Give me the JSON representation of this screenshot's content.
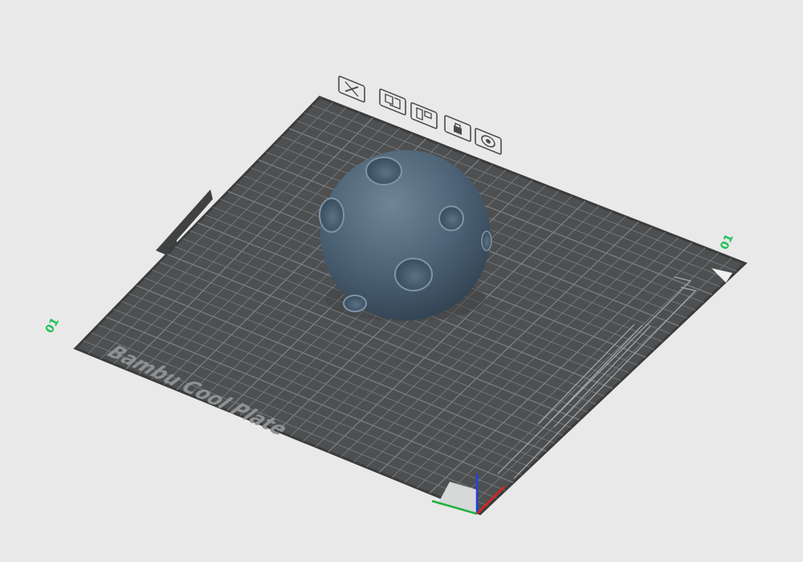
{
  "scene": {
    "background_color": "#e9e9e9",
    "plate_color": "#4d4f50",
    "grid_color": "#7c7e80",
    "model_color": "#4a6175",
    "number_color": "#22c05a"
  },
  "plate": {
    "brand_label": "Bambu Cool Plate",
    "number_left": "01",
    "number_right": "01"
  },
  "plate_toolbar": {
    "items": [
      {
        "name": "close-icon",
        "label": "remove plate"
      },
      {
        "name": "arrange-icon",
        "label": "arrange objects"
      },
      {
        "name": "orient-icon",
        "label": "auto orient"
      },
      {
        "name": "lock-icon",
        "label": "lock plate"
      },
      {
        "name": "plate-settings-icon",
        "label": "plate settings"
      }
    ]
  },
  "axes": {
    "x_color": "#e02020",
    "y_color": "#20b040",
    "z_color": "#2040e0"
  }
}
